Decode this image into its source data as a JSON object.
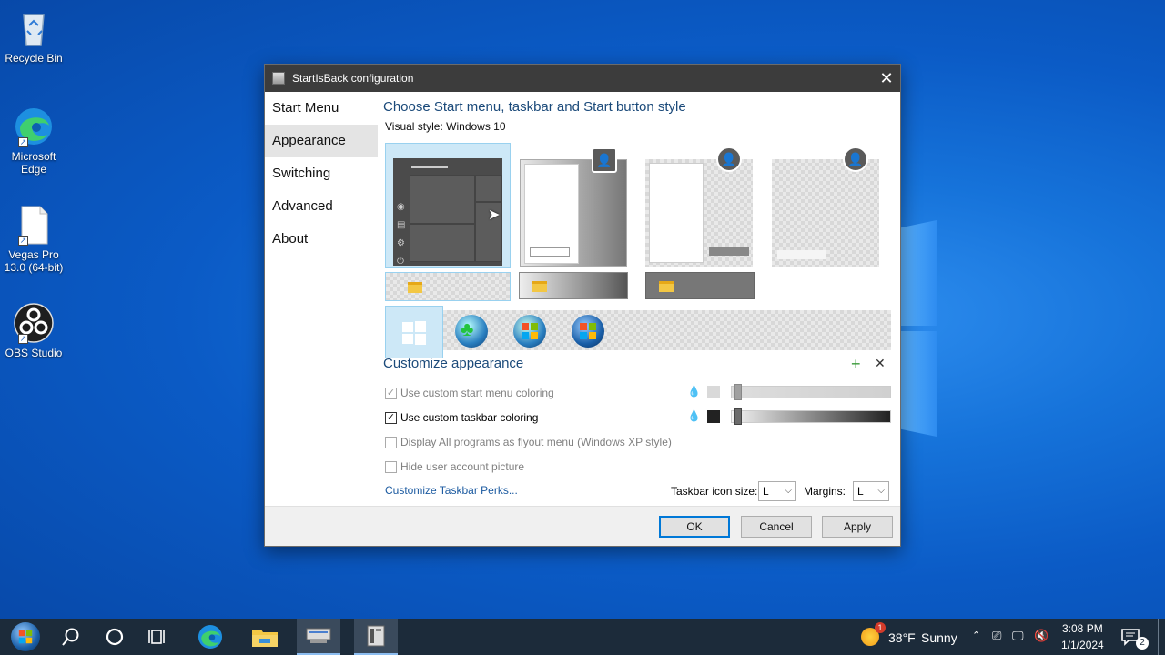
{
  "desktop": {
    "icons": [
      {
        "label": "Recycle Bin"
      },
      {
        "label": "Microsoft Edge"
      },
      {
        "label": "Vegas Pro 13.0 (64-bit)"
      },
      {
        "label": "OBS Studio"
      }
    ]
  },
  "dialog": {
    "title": "StartIsBack configuration",
    "nav": [
      "Start Menu",
      "Appearance",
      "Switching",
      "Advanced",
      "About"
    ],
    "selected_nav": "Appearance",
    "heading": "Choose Start menu, taskbar and Start button style",
    "visual_style_label": "Visual style:",
    "visual_style_value": "Windows 10",
    "customize_heading": "Customize appearance",
    "options": [
      {
        "label": "Use custom start menu coloring",
        "checked": true,
        "enabled": false
      },
      {
        "label": "Use custom taskbar coloring",
        "checked": true,
        "enabled": true
      },
      {
        "label": "Display All programs as flyout menu (Windows XP style)",
        "checked": false,
        "enabled": false
      },
      {
        "label": "Hide user account picture",
        "checked": false,
        "enabled": false
      }
    ],
    "perks_link": "Customize Taskbar Perks...",
    "taskbar_icon_size_label": "Taskbar icon size:",
    "taskbar_icon_size_value": "L",
    "margins_label": "Margins:",
    "margins_value": "L",
    "ok_label": "OK",
    "cancel_label": "Cancel",
    "apply_label": "Apply",
    "check_glyph": "✓"
  },
  "taskbar": {
    "weather_temp": "38°F",
    "weather_desc": "Sunny",
    "weather_badge": "1",
    "time": "3:08 PM",
    "date": "1/1/2024",
    "notification_count": "2"
  },
  "colors": {
    "accent": "#0078d7",
    "heading": "#1b4a7a",
    "taskbar": "#1c2b3a"
  }
}
